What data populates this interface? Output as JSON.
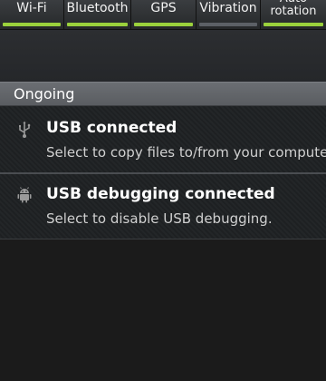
{
  "quick_settings": {
    "toggles": [
      {
        "label": "Wi-Fi",
        "bar_color": "#9bd13c"
      },
      {
        "label": "Bluetooth",
        "bar_color": "#9bd13c"
      },
      {
        "label": "GPS",
        "bar_color": "#9bd13c"
      },
      {
        "label": "Vibration",
        "bar_color": "#5c6066"
      },
      {
        "label": "Auto rotation",
        "bar_color": "#9bd13c"
      }
    ]
  },
  "section": {
    "title": "Ongoing"
  },
  "notifications": [
    {
      "icon": "usb-icon",
      "title": "USB connected",
      "text": "Select to copy files to/from your computer."
    },
    {
      "icon": "android-debug-icon",
      "title": "USB debugging connected",
      "text": "Select to disable USB debugging."
    }
  ],
  "colors": {
    "accent_on": "#9bd13c",
    "accent_off": "#5c6066",
    "header_bg": "#63666a",
    "notification_bg": "#1f2224"
  }
}
